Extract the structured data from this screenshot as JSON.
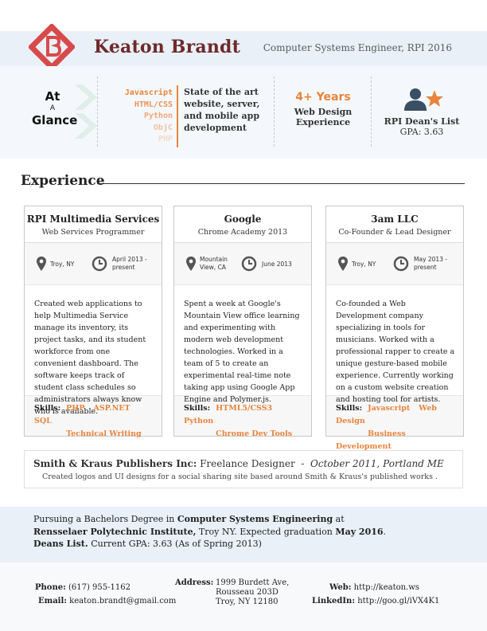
{
  "header": {
    "name": "Keaton Brandt",
    "subtitle": "Computer Systems Engineer, RPI 2016"
  },
  "glance": {
    "at_label": [
      "At",
      "A",
      "Glance"
    ],
    "languages": [
      "Javascript",
      "HTML/CSS",
      "Python",
      "ObjC",
      "PHP"
    ],
    "description": "State of the art website, server, and mobile app development",
    "years": "4+ Years",
    "years_sub": "Web Design Experience",
    "dean_title": "RPI Dean's List",
    "gpa": "GPA: 3.63"
  },
  "experience": {
    "title": "Experience",
    "cards": [
      {
        "company": "RPI Multimedia Services",
        "role": "Web Services Programmer",
        "location": "Troy, NY",
        "date": "April 2013 - present",
        "description": "Created web applications to help Multimedia Service manage its inventory, its project tasks, and its student workforce from one convenient dashboard. The software keeps track of student class schedules so administrators always know who is available.",
        "skills_label": "Skills:",
        "skills": [
          "PHP",
          "ASP.NET",
          "SQL",
          "Technical Writing"
        ]
      },
      {
        "company": "Google",
        "role": "Chrome Academy 2013",
        "location": "Mountain View, CA",
        "date": "June 2013",
        "description": "Spent a week at Google's Mountain View office learning and experimenting with modern web development technologies. Worked in a team of 5 to create an experimental real-time note taking app using Google App Engine and Polymer.js.",
        "skills_label": "Skills:",
        "skills": [
          "HTML5/CSS3",
          "Python",
          "Chrome Dev Tools"
        ]
      },
      {
        "company": "3am LLC",
        "role": "Co-Founder & Lead Designer",
        "location": "Troy, NY",
        "date": "May 2013 - present",
        "description": "Co-founded a Web Development company specializing in tools for musicians. Worked with a professional rapper to create a unique gesture-based mobile experience. Currently working on a custom website creation and hosting tool for artists.",
        "skills_label": "Skills:",
        "skills": [
          "Javascript",
          "Web Design",
          "Business Development"
        ]
      }
    ],
    "freelance": {
      "company": "Smith & Kraus Publishers Inc:",
      "role": "Freelance Designer",
      "separator": "-",
      "when": "October 2011, Portland ME",
      "description": "Created logos and UI designs for a social sharing site based around Smith & Kraus's published works ."
    }
  },
  "education": {
    "l1_pre": "Pursuing a Bachelors Degree in ",
    "l1_bold": "Computer Systems Engineering",
    "l1_post": " at",
    "l2_bold": "Rensselaer Polytechnic Institute,",
    "l2_mid": " Troy NY. Expected graduation ",
    "l2_bold2": "May 2016",
    "l2_post": ".",
    "l3_bold": "Deans List.",
    "l3_post": " Current GPA: 3.63 (As of Spring 2013)"
  },
  "contact": {
    "phone_label": "Phone:",
    "phone": "(617) 955-1162",
    "email_label": "Email:",
    "email": "keaton.brandt@gmail.com",
    "address_label": "Address:",
    "address": [
      "1999 Burdett Ave,",
      "Rousseau 203D",
      "Troy, NY 12180"
    ],
    "web_label": "Web:",
    "web": "http://keaton.ws",
    "linkedin_label": "LinkedIn:",
    "linkedin": "http://goo.gl/iVX4K1"
  },
  "colors": {
    "accent": "#e8843c",
    "name": "#6e2a2a",
    "logo": "#d84a4a",
    "band": "#e9f0f7",
    "icon": "#3a4f63"
  }
}
